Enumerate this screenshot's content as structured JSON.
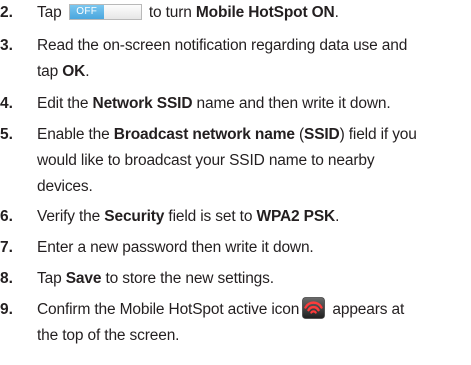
{
  "steps": [
    {
      "num": "2.",
      "t": [
        "Tap ",
        "",
        " to turn ",
        "Mobile HotSpot ON",
        "."
      ],
      "toggle_label": "OFF"
    },
    {
      "num": "3.",
      "l1": "Read the on-screen notification regarding data use and",
      "l2a": "tap ",
      "l2b": "OK",
      "l2c": "."
    },
    {
      "num": "4.",
      "a": "Edit the ",
      "b": "Network SSID",
      "c": " name and then write it down."
    },
    {
      "num": "5.",
      "l1a": "Enable the ",
      "l1b": "Broadcast network name",
      "l1c": " (",
      "l1d": "SSID",
      "l1e": ") field if you",
      "l2": "would like to broadcast your SSID name to nearby",
      "l3": "devices."
    },
    {
      "num": "6.",
      "a": "Verify the ",
      "b": "Security",
      "c": " field is set to ",
      "d": "WPA2 PSK",
      "e": "."
    },
    {
      "num": "7.",
      "a": "Enter a new password then write it down."
    },
    {
      "num": "8.",
      "a": "Tap ",
      "b": "Save",
      "c": " to store the new settings."
    },
    {
      "num": "9.",
      "l1a": "Confirm the Mobile HotSpot active icon",
      "l1b": " appears at",
      "l2": "the top of the screen.",
      "icon": "mobile-hotspot-active-icon"
    }
  ],
  "colors": {
    "text": "#231f20",
    "toggle_blue": "#4aa6de",
    "icon_red": "#d9252a"
  }
}
